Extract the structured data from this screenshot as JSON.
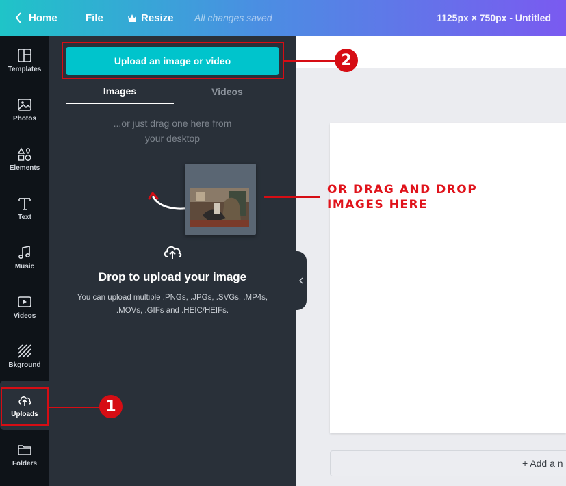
{
  "topbar": {
    "home_label": "Home",
    "file_label": "File",
    "resize_label": "Resize",
    "saved_status": "All changes saved",
    "document_title": "1125px × 750px - Untitled"
  },
  "rail": {
    "items": [
      {
        "label": "Templates",
        "icon": "templates-icon"
      },
      {
        "label": "Photos",
        "icon": "photos-icon"
      },
      {
        "label": "Elements",
        "icon": "elements-icon"
      },
      {
        "label": "Text",
        "icon": "text-icon"
      },
      {
        "label": "Music",
        "icon": "music-icon"
      },
      {
        "label": "Videos",
        "icon": "videos-icon"
      },
      {
        "label": "Bkground",
        "icon": "background-icon"
      },
      {
        "label": "Uploads",
        "icon": "upload-cloud-icon"
      },
      {
        "label": "Folders",
        "icon": "folder-icon"
      }
    ],
    "active": "Uploads"
  },
  "panel": {
    "upload_button": "Upload an image or video",
    "tabs": [
      {
        "label": "Images",
        "active": true
      },
      {
        "label": "Videos",
        "active": false
      }
    ],
    "drag_hint_line1": "...or just drag one here from",
    "drag_hint_line2": "your desktop",
    "drop_title": "Drop to upload your image",
    "drop_desc_line1": "You can upload multiple .PNGs, .JPGs, .SVGs, .MP4s,",
    "drop_desc_line2": ".MOVs, .GIFs and .HEIC/HEIFs."
  },
  "canvas": {
    "add_page_label": "+ Add a n"
  },
  "annotations": {
    "badge_1": "1",
    "badge_2": "2",
    "drag_text_line1": "OR DRAG AND DROP",
    "drag_text_line2": "IMAGES HERE",
    "color": "#d60d14"
  },
  "colors": {
    "accent": "#00c4cc",
    "panel_bg": "#293039",
    "rail_bg": "#0e1318"
  }
}
